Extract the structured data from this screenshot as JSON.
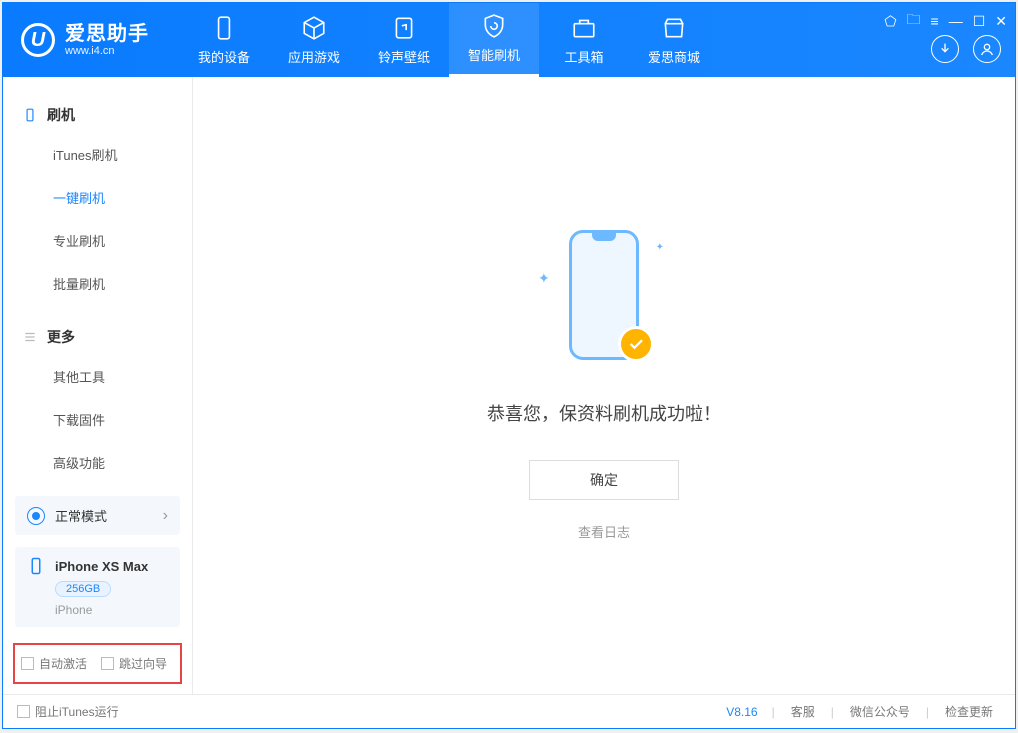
{
  "app": {
    "title": "爱思助手",
    "subtitle": "www.i4.cn"
  },
  "tabs": {
    "device": "我的设备",
    "apps": "应用游戏",
    "ringtones": "铃声壁纸",
    "flash": "智能刷机",
    "toolbox": "工具箱",
    "store": "爱思商城"
  },
  "sidebar": {
    "flash_header": "刷机",
    "itunes_flash": "iTunes刷机",
    "one_click": "一键刷机",
    "pro_flash": "专业刷机",
    "batch_flash": "批量刷机",
    "more_header": "更多",
    "other_tools": "其他工具",
    "download_fw": "下载固件",
    "advanced": "高级功能"
  },
  "status": {
    "mode": "正常模式"
  },
  "device": {
    "name": "iPhone XS Max",
    "storage": "256GB",
    "type": "iPhone"
  },
  "options": {
    "auto_activate": "自动激活",
    "skip_guide": "跳过向导"
  },
  "main": {
    "success": "恭喜您，保资料刷机成功啦！",
    "ok": "确定",
    "view_log": "查看日志"
  },
  "footer": {
    "block_itunes": "阻止iTunes运行",
    "version": "V8.16",
    "support": "客服",
    "wechat": "微信公众号",
    "update": "检查更新"
  }
}
